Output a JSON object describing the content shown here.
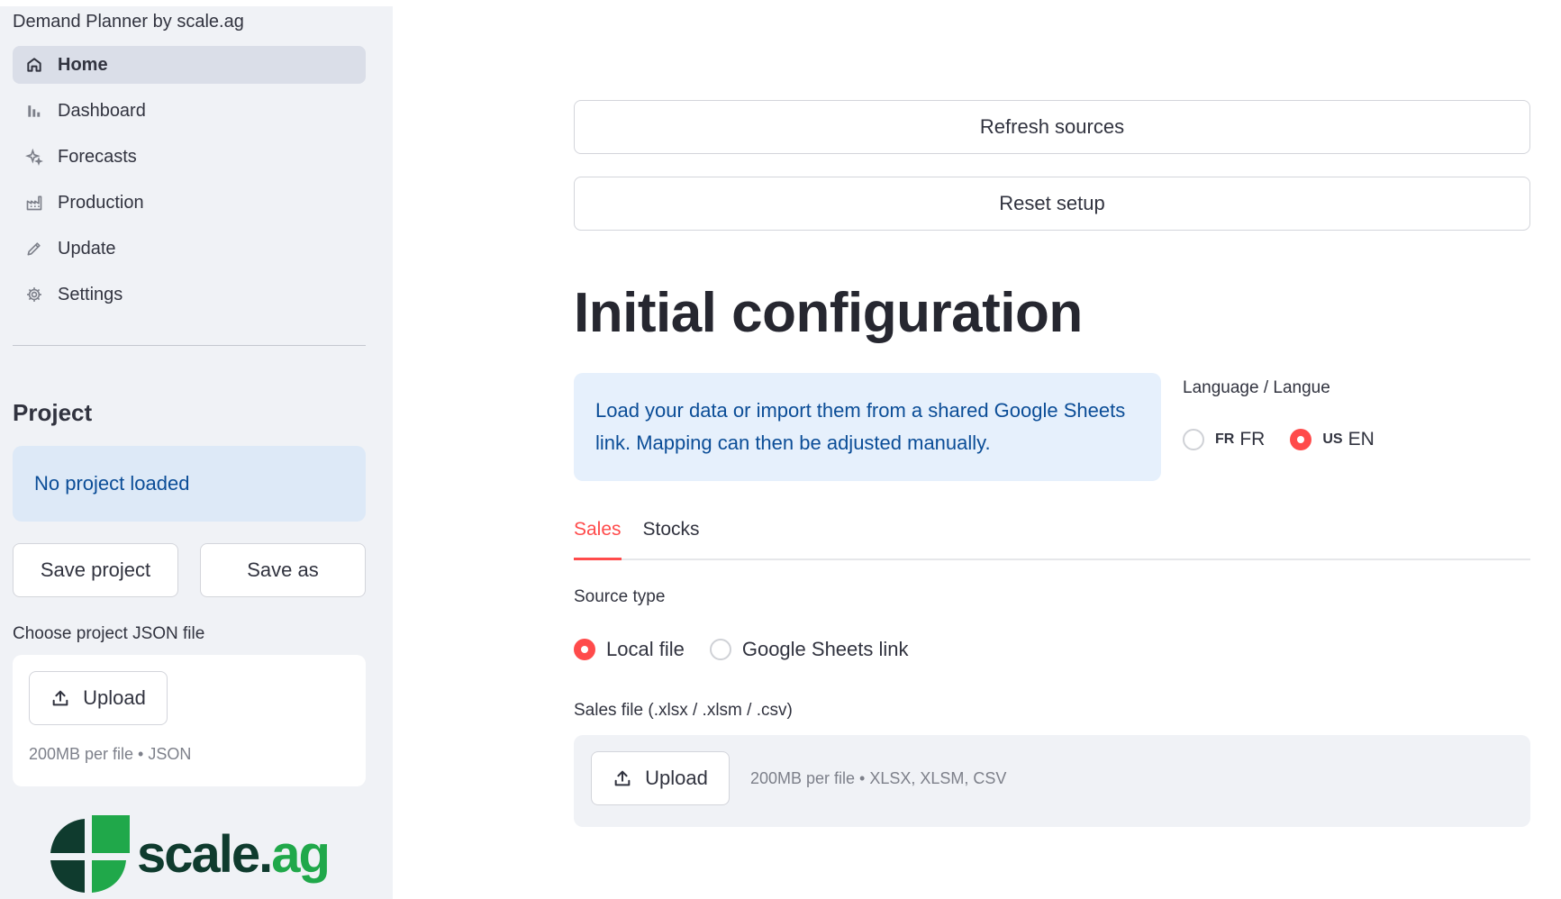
{
  "sidebar": {
    "app_title": "Demand Planner by scale.ag",
    "nav": [
      {
        "label": "Home",
        "icon": "home-icon",
        "active": true
      },
      {
        "label": "Dashboard",
        "icon": "bar-chart-icon",
        "active": false
      },
      {
        "label": "Forecasts",
        "icon": "sparkle-icon",
        "active": false
      },
      {
        "label": "Production",
        "icon": "factory-icon",
        "active": false
      },
      {
        "label": "Update",
        "icon": "pencil-icon",
        "active": false
      },
      {
        "label": "Settings",
        "icon": "gear-icon",
        "active": false
      }
    ],
    "project_heading": "Project",
    "project_status": "No project loaded",
    "save_project_label": "Save project",
    "save_as_label": "Save as",
    "choose_file_label": "Choose project JSON file",
    "upload_label": "Upload",
    "upload_hint": "200MB per file • JSON",
    "logo": {
      "text_main": "scale.",
      "text_accent": "ag"
    }
  },
  "main": {
    "refresh_label": "Refresh sources",
    "reset_label": "Reset setup",
    "title": "Initial configuration",
    "info_text": "Load your data or import them from a shared Google Sheets link. Mapping can then be adjusted manually.",
    "language": {
      "label": "Language / Langue",
      "options": [
        {
          "flag": "FR",
          "label": "FR",
          "selected": false
        },
        {
          "flag": "US",
          "label": "EN",
          "selected": true
        }
      ]
    },
    "tabs": [
      {
        "label": "Sales",
        "active": true
      },
      {
        "label": "Stocks",
        "active": false
      }
    ],
    "source_type": {
      "label": "Source type",
      "options": [
        {
          "label": "Local file",
          "selected": true
        },
        {
          "label": "Google Sheets link",
          "selected": false
        }
      ]
    },
    "file_label": "Sales file (.xlsx / .xlsm / .csv)",
    "upload_label": "Upload",
    "upload_hint": "200MB per file • XLSX, XLSM, CSV"
  },
  "colors": {
    "accent": "#ff4b4b",
    "info_text": "#0b4d97",
    "sidebar_bg": "#f0f2f6",
    "logo_green": "#20a84a",
    "logo_dark": "#0f3b2e"
  }
}
